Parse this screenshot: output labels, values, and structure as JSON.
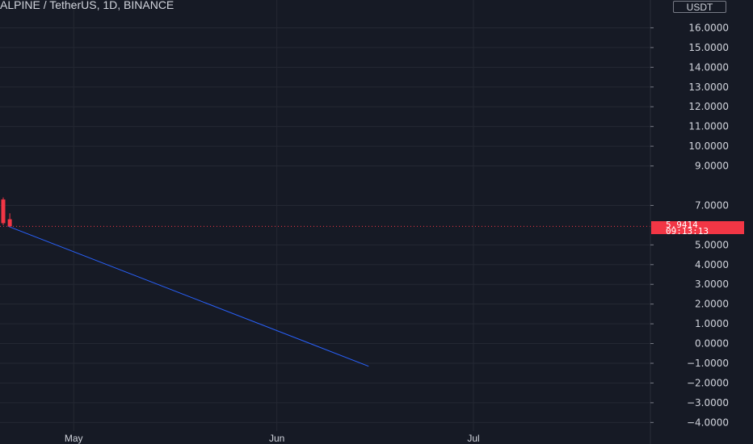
{
  "header": {
    "title": "ALPINE / TetherUS, 1D, BINANCE",
    "currency": "USDT"
  },
  "colors": {
    "background": "#161a25",
    "grid": "#242833",
    "axis_text": "#d1d4dc",
    "down_candle": "#f23645",
    "trend_line": "#2962ff",
    "price_line": "#f23645"
  },
  "price_tag": {
    "price": "5.9414",
    "countdown": "09:13:13"
  },
  "chart_data": {
    "type": "candlestick",
    "title": "ALPINE / TetherUS, 1D, BINANCE",
    "y_unit": "USDT",
    "ylim": [
      -4.6,
      17.0
    ],
    "y_ticks": [
      16,
      15,
      14,
      13,
      12,
      11,
      10,
      9,
      7,
      5,
      4,
      3,
      2,
      1,
      0,
      -1,
      -2,
      -3,
      -4
    ],
    "y_tick_labels": [
      "16.0000",
      "15.0000",
      "14.0000",
      "13.0000",
      "12.0000",
      "11.0000",
      "10.0000",
      "9.0000",
      "7.0000",
      "5.0000",
      "4.0000",
      "3.0000",
      "2.0000",
      "1.0000",
      "0.0000",
      "−1.0000",
      "−2.0000",
      "−3.0000",
      "−4.0000"
    ],
    "x_labels": [
      {
        "label": "May",
        "date": "2024-05-01"
      },
      {
        "label": "Jun",
        "date": "2024-06-01"
      },
      {
        "label": "Jul",
        "date": "2024-07-01"
      }
    ],
    "xlim": [
      "2024-04-20",
      "2024-07-28"
    ],
    "candles": [
      {
        "date": "2024-04-20",
        "open": 7.3,
        "high": 7.4,
        "low": 6.0,
        "close": 6.1
      },
      {
        "date": "2024-04-21",
        "open": 6.3,
        "high": 6.6,
        "low": 5.9,
        "close": 5.9414
      }
    ],
    "trend_line": {
      "start": {
        "date": "2024-04-21",
        "value": 5.9414
      },
      "end": {
        "date": "2024-06-15",
        "value": -1.15
      }
    },
    "last_price": 5.9414,
    "grid": true
  }
}
